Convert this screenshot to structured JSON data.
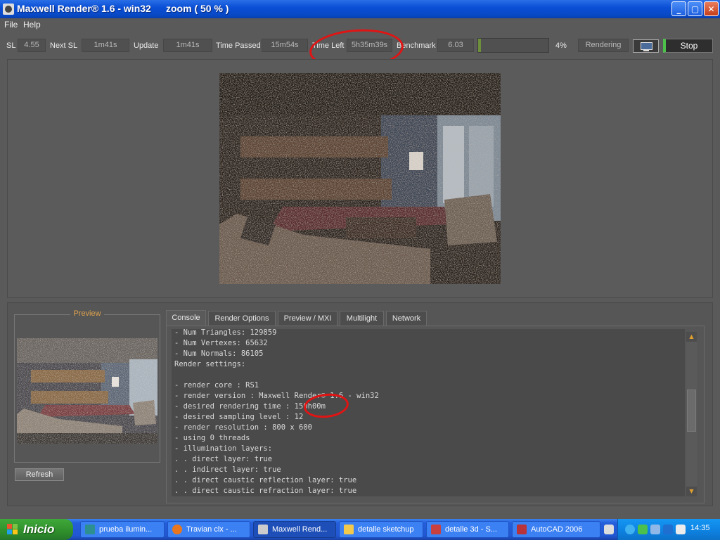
{
  "window": {
    "title": "Maxwell Render® 1.6 - win32",
    "zoom": "zoom ( 50 % )"
  },
  "menu": [
    "File",
    "Help"
  ],
  "status": {
    "sl_label": "SL",
    "sl_value": "4.55",
    "next_sl_label": "Next SL",
    "next_sl_value": "1m41s",
    "update_label": "Update",
    "update_value": "1m41s",
    "time_passed_label": "Time Passed",
    "time_passed_value": "15m54s",
    "time_left_label": "Time Left",
    "time_left_value": "5h35m39s",
    "benchmark_label": "Benchmark",
    "benchmark_value": "6.03",
    "progress_percent": "4%",
    "progress_fraction": 0.04,
    "state": "Rendering",
    "stop_label": "Stop"
  },
  "preview": {
    "label": "Preview",
    "refresh_label": "Refresh"
  },
  "tabs": [
    "Console",
    "Render Options",
    "Preview / MXI",
    "Multilight",
    "Network"
  ],
  "console_lines": [
    "- Num Triangles: 129859",
    "- Num Vertexes: 65632",
    "- Num Normals: 86105",
    "Render settings:",
    "",
    "- render core : RS1",
    "- render version : Maxwell Render® 1.6 - win32",
    "- desired rendering time : 150h00m",
    "- desired sampling level : 12",
    "- render resolution : 800 x 600",
    "- using 0 threads",
    "- illumination layers:",
    ". . direct layer: true",
    ". . indirect layer: true",
    ". . direct caustic reflection layer: true",
    ". . direct caustic refraction layer: true"
  ],
  "taskbar": {
    "start_label": "Inicio",
    "tasks": [
      {
        "label": "prueba ilumin...",
        "icon": "browser-icon"
      },
      {
        "label": "Travian clx - ...",
        "icon": "firefox-icon"
      },
      {
        "label": "Maxwell Rend...",
        "icon": "maxwell-icon"
      },
      {
        "label": "detalle sketchup",
        "icon": "folder-icon"
      },
      {
        "label": "detalle 3d - S...",
        "icon": "sketchup-icon"
      },
      {
        "label": "AutoCAD 2006",
        "icon": "autocad-icon"
      }
    ],
    "clock": "14:35"
  },
  "colors": {
    "annotation": "#e11414",
    "accent_orange": "#e0a34c",
    "stop_green": "#4dc24a"
  }
}
